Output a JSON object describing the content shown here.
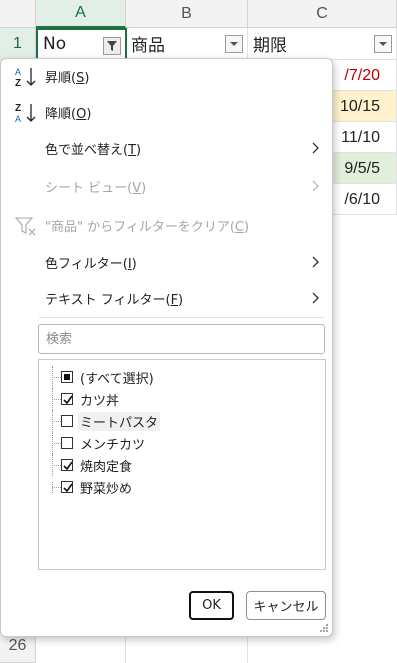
{
  "sheet": {
    "columns": [
      "A",
      "B",
      "C"
    ],
    "header_row_number": "1",
    "bottom_row_number": "26",
    "headers": {
      "a": "No",
      "b": "商品",
      "c": "期限"
    },
    "visible_dates": [
      {
        "text": "/7/20",
        "color": "#c00000",
        "fill": "#ffffff"
      },
      {
        "text": "10/15",
        "color": "#222222",
        "fill": "#fff2cc"
      },
      {
        "text": "11/10",
        "color": "#222222",
        "fill": "#ffffff"
      },
      {
        "text": "9/5/5",
        "color": "#222222",
        "fill": "#e2efda"
      },
      {
        "text": "/6/10",
        "color": "#222222",
        "fill": "#ffffff"
      }
    ],
    "accent_color": "#217346"
  },
  "menu": {
    "sort_asc": {
      "label": "昇順(",
      "key": "S",
      "close": ")"
    },
    "sort_desc": {
      "label": "降順(",
      "key": "O",
      "close": ")"
    },
    "sort_by_color": {
      "label": "色で並べ替え(",
      "key": "T",
      "close": ")"
    },
    "sheet_view": {
      "label": "シート ビュー(",
      "key": "V",
      "close": ")"
    },
    "clear_filter": {
      "label": "\"商品\" からフィルターをクリア(",
      "key": "C",
      "close": ")"
    },
    "color_filter": {
      "label": "色フィルター(",
      "key": "I",
      "close": ")"
    },
    "text_filter": {
      "label": "テキスト フィルター(",
      "key": "F",
      "close": ")"
    }
  },
  "search": {
    "placeholder": "検索"
  },
  "filter_items": [
    {
      "label": "(すべて選択)",
      "state": "partial"
    },
    {
      "label": "カツ丼",
      "state": "checked"
    },
    {
      "label": "ミートパスタ",
      "state": "unchecked"
    },
    {
      "label": "メンチカツ",
      "state": "unchecked"
    },
    {
      "label": "焼肉定食",
      "state": "checked"
    },
    {
      "label": "野菜炒め",
      "state": "checked"
    }
  ],
  "buttons": {
    "ok": "OK",
    "cancel": "キャンセル"
  }
}
